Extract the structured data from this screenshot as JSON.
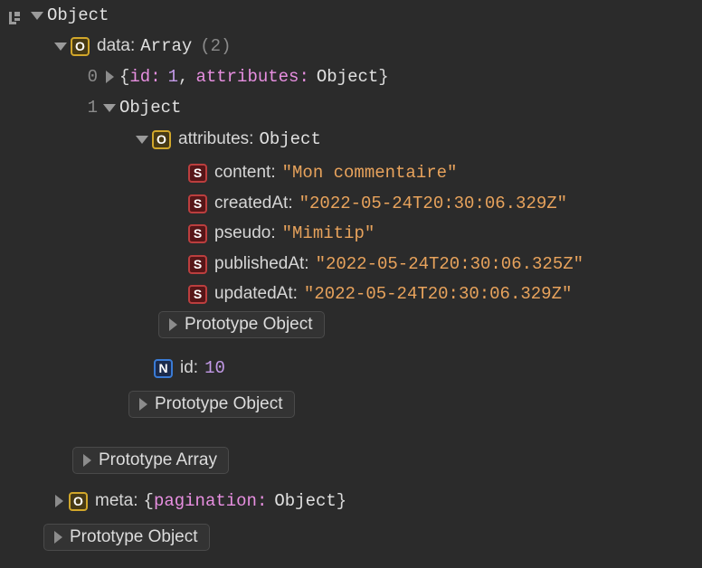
{
  "app": {
    "panel": "console-object-inspector",
    "theme": "dark",
    "background_color": "#2b2b2b"
  },
  "icons": {
    "console_source": "console-log-icon",
    "expanded": "triangle-down-icon",
    "collapsed": "triangle-right-icon"
  },
  "badges": {
    "object": {
      "glyph": "O",
      "fill": "#473a15",
      "border": "#d1a72b"
    },
    "string": {
      "glyph": "S",
      "fill": "#561618",
      "border": "#bb3e3e"
    },
    "number": {
      "glyph": "N",
      "fill": "#1b2b4d",
      "border": "#3a7bd5"
    }
  },
  "colors": {
    "key": "#d6d6d6",
    "string_value": "#e8a35c",
    "number_value": "#c39ae8",
    "preview_key": "#e78fe0",
    "type_name": "#e0e0e0",
    "dim": "#8b8b8b"
  },
  "tree": {
    "root": {
      "type_label": "Object"
    },
    "data_node": {
      "key": "data:",
      "type_label": "Array",
      "count": "(2)"
    },
    "item0": {
      "index": "0",
      "preview_open": "{",
      "preview_key1": "id:",
      "preview_val1": "1",
      "preview_comma": ",",
      "preview_key2": "attributes:",
      "preview_val2": "Object",
      "preview_close": "}"
    },
    "item1": {
      "index": "1",
      "type_label": "Object"
    },
    "attributes_node": {
      "key": "attributes:",
      "type_label": "Object"
    },
    "properties": [
      {
        "key": "content:",
        "value": "\"Mon commentaire\"",
        "badge": "S"
      },
      {
        "key": "createdAt:",
        "value": "\"2022-05-24T20:30:06.329Z\"",
        "badge": "S"
      },
      {
        "key": "pseudo:",
        "value": "\"Mimitip\"",
        "badge": "S"
      },
      {
        "key": "publishedAt:",
        "value": "\"2022-05-24T20:30:06.325Z\"",
        "badge": "S"
      },
      {
        "key": "updatedAt:",
        "value": "\"2022-05-24T20:30:06.329Z\"",
        "badge": "S"
      }
    ],
    "id_node": {
      "key": "id:",
      "value": "10",
      "badge": "N"
    },
    "meta_node": {
      "key": "meta:",
      "preview_open": "{",
      "preview_key": "pagination:",
      "preview_val": "Object",
      "preview_close": "}"
    },
    "prototypes": {
      "attributes_proto": "Prototype Object",
      "item1_proto": "Prototype Object",
      "array_proto": "Prototype Array",
      "root_proto": "Prototype Object"
    }
  }
}
